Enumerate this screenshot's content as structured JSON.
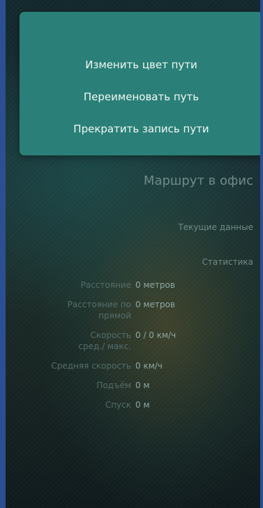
{
  "menu": {
    "items": [
      {
        "label": "Изменить цвет пути"
      },
      {
        "label": "Переименовать путь"
      },
      {
        "label": "Прекратить запись пути"
      }
    ]
  },
  "route": {
    "name": "Маршрут в офис",
    "current_data_label": "Текущие данные",
    "statistics_label": "Статистика"
  },
  "stats": [
    {
      "label": "Расстояние",
      "value": "0 метров"
    },
    {
      "label": "Расстояние по прямой",
      "value": "0 метров"
    },
    {
      "label": "Скорость сред./ макс.",
      "value": "0 / 0 км/ч"
    },
    {
      "label": "Средняя скорость",
      "value": "0 км/ч"
    },
    {
      "label": "Подъём",
      "value": "0 м"
    },
    {
      "label": "Спуск",
      "value": "0 м"
    }
  ]
}
